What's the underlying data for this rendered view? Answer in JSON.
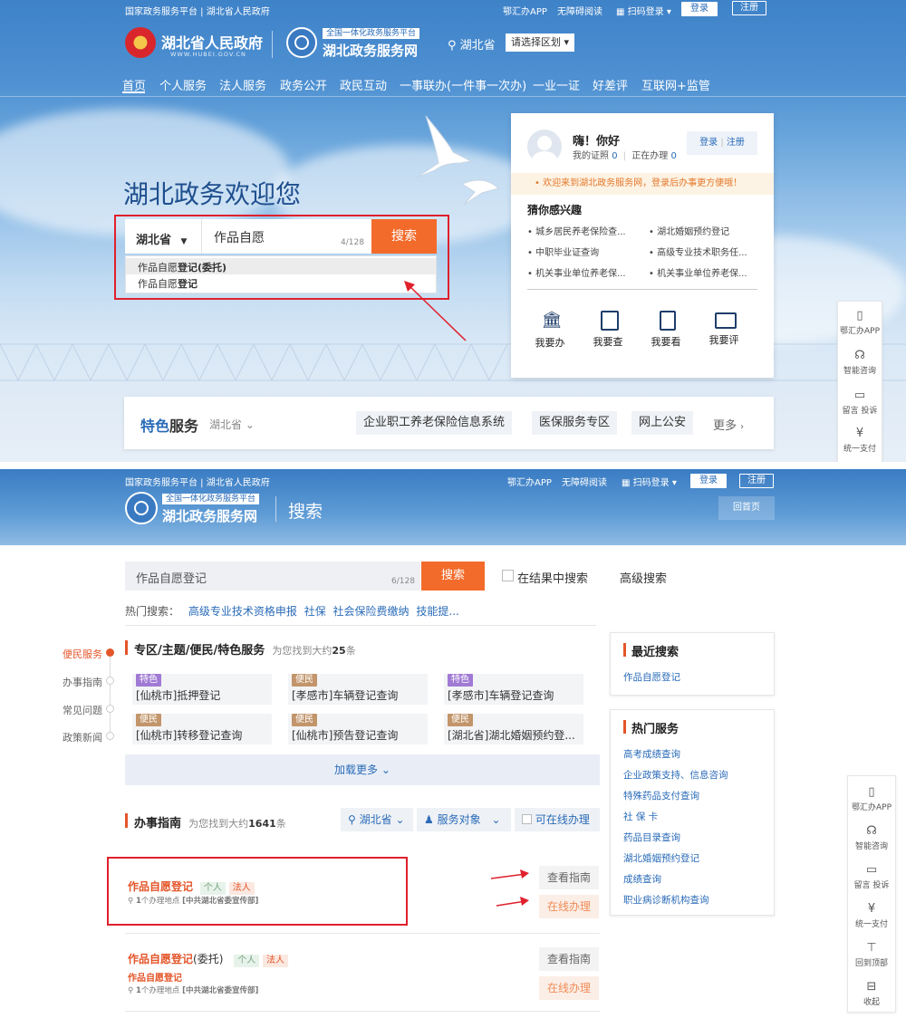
{
  "colors": {
    "brand_blue": "#2a6bb8",
    "accent_orange": "#e4552a",
    "search_orange": "#f36b2b",
    "highlight_red": "#e0202c"
  },
  "topbar": {
    "left": "国家政务服务平台 | 湖北省人民政府",
    "app": "鄂汇办APP",
    "accessible": "无障碍阅读",
    "scan_login": "扫码登录",
    "login": "登录",
    "register": "注册"
  },
  "header": {
    "gov_title": "湖北省人民政府",
    "gov_url": "WWW.HUBEI.GOV.CN",
    "portal_badge": "全国一体化政务服务平台",
    "portal_title": "湖北政务服务网",
    "region": "湖北省",
    "region_select": "请选择区划"
  },
  "nav": [
    "首页",
    "个人服务",
    "法人服务",
    "政务公开",
    "政民互动",
    "一事联办(一件事一次办)",
    "一业一证",
    "好差评",
    "互联网+监管"
  ],
  "hero": {
    "welcome": "湖北政务欢迎您"
  },
  "search1": {
    "scope": "湖北省",
    "value": "作品自愿",
    "counter": "4/128",
    "button": "搜索",
    "suggestions": [
      {
        "prefix": "作品自愿",
        "bold": "登记(委托)"
      },
      {
        "prefix": "作品自愿",
        "bold": "登记"
      }
    ]
  },
  "user_card": {
    "greeting": "嗨！你好",
    "certs_label": "我的证照",
    "certs_count": "0",
    "handling_label": "正在办理",
    "handling_count": "0",
    "login": "登录",
    "register": "注册",
    "notice": "欢迎来到湖北政务服务网，登录后办事更方便哦！",
    "interest_title": "猜你感兴趣",
    "interests": [
      "城乡居民养老保险查...",
      "湖北婚姻预约登记",
      "中职毕业证查询",
      "高级专业技术职务任...",
      "机关事业单位养老保...",
      "机关事业单位养老保..."
    ],
    "actions": [
      {
        "label": "我要办",
        "icon": "bank-icon"
      },
      {
        "label": "我要查",
        "icon": "query-icon"
      },
      {
        "label": "我要看",
        "icon": "view-icon"
      },
      {
        "label": "我要评",
        "icon": "comment-icon"
      }
    ]
  },
  "featured": {
    "title_a": "特色",
    "title_b": "服务",
    "region": "湖北省",
    "items": [
      "企业职工养老保险信息系统",
      "医保服务专区",
      "网上公安"
    ],
    "more": "更多"
  },
  "float1": [
    {
      "label": "鄂汇办APP",
      "icon": "phone-icon"
    },
    {
      "label": "智能咨询",
      "icon": "headset-icon"
    },
    {
      "label": "留言 投诉",
      "icon": "message-icon"
    },
    {
      "label": "统一支付",
      "icon": "yuan-icon"
    }
  ],
  "page2": {
    "topbar": {
      "left": "国家政务服务平台 | 湖北省人民政府",
      "app": "鄂汇办APP",
      "accessible": "无障碍阅读",
      "scan_login": "扫码登录",
      "login": "登录",
      "register": "注册"
    },
    "portal_badge": "全国一体化政务服务平台",
    "portal_title": "湖北政务服务网",
    "page_title": "搜索",
    "home_link": "回首页",
    "search": {
      "value": "作品自愿登记",
      "counter": "6/128",
      "button": "搜索",
      "in_results": "在结果中搜索",
      "advanced": "高级搜索"
    },
    "hot": {
      "label": "热门搜索：",
      "items": [
        "高级专业技术资格申报",
        "社保",
        "社会保险费缴纳",
        "技能提..."
      ]
    },
    "left_nav": [
      "便民服务",
      "办事指南",
      "常见问题",
      "政策新闻"
    ],
    "section1": {
      "title": "专区/主题/便民/特色服务",
      "count_prefix": "为您找到大约",
      "count": "25",
      "count_suffix": "条",
      "cards": [
        {
          "tag": "特色",
          "text": "[仙桃市]抵押登记"
        },
        {
          "tag": "便民",
          "text": "[孝感市]车辆登记查询"
        },
        {
          "tag": "特色",
          "text": "[孝感市]车辆登记查询"
        },
        {
          "tag": "便民",
          "text": "[仙桃市]转移登记查询"
        },
        {
          "tag": "便民",
          "text": "[仙桃市]预告登记查询"
        },
        {
          "tag": "便民",
          "text": "[湖北省]湖北婚姻预约登..."
        }
      ],
      "load_more": "加载更多"
    },
    "section2": {
      "title": "办事指南",
      "count_prefix": "为您找到大约",
      "count": "1641",
      "count_suffix": "条",
      "filter_region": "湖北省",
      "filter_target": "服务对象",
      "filter_online": "可在线办理",
      "results": [
        {
          "title": "作品自愿登记",
          "suffix": "",
          "tags": [
            "个人",
            "法人"
          ],
          "sub": "",
          "loc_count": "1",
          "loc_text": "个办理地点",
          "dept": "[中共湖北省委宣传部]",
          "view": "查看指南",
          "online": "在线办理"
        },
        {
          "title": "作品自愿登记",
          "suffix": "(委托)",
          "tags": [
            "个人",
            "法人"
          ],
          "sub": "作品自愿登记",
          "loc_count": "1",
          "loc_text": "个办理地点",
          "dept": "[中共湖北省委宣传部]",
          "view": "查看指南",
          "online": "在线办理"
        }
      ]
    },
    "recent": {
      "title": "最近搜索",
      "items": [
        "作品自愿登记"
      ]
    },
    "hot_services": {
      "title": "热门服务",
      "items": [
        "高考成绩查询",
        "企业政策支持、信息咨询",
        "特殊药品支付查询",
        "社 保 卡",
        "药品目录查询",
        "湖北婚姻预约登记",
        "成绩查询",
        "职业病诊断机构查询"
      ]
    },
    "float2": [
      {
        "label": "鄂汇办APP",
        "icon": "phone-icon"
      },
      {
        "label": "智能咨询",
        "icon": "headset-icon"
      },
      {
        "label": "留言 投诉",
        "icon": "message-icon"
      },
      {
        "label": "统一支付",
        "icon": "yuan-icon"
      },
      {
        "label": "回到顶部",
        "icon": "to-top-icon"
      },
      {
        "label": "收起",
        "icon": "collapse-icon"
      }
    ]
  }
}
